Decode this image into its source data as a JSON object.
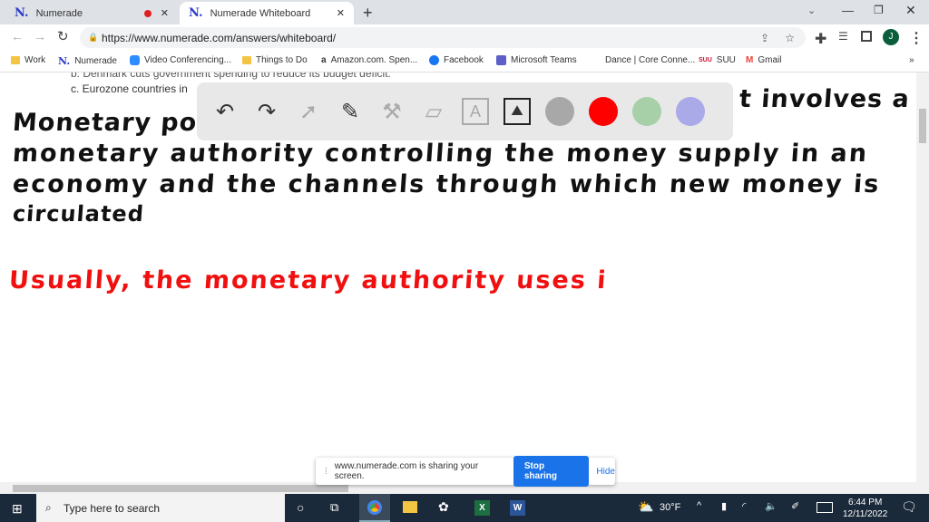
{
  "browser": {
    "tabs": [
      {
        "label": "Numerade",
        "recording": true
      },
      {
        "label": "Numerade Whiteboard",
        "active": true
      }
    ],
    "url": "https://www.numerade.com/answers/whiteboard/",
    "profile_initial": "J",
    "bookmarks": [
      "Work",
      "Numerade",
      "Video Conferencing...",
      "Things to Do",
      "Amazon.com. Spen...",
      "Facebook",
      "Microsoft Teams",
      "Dance | Core Conne...",
      "SUU",
      "Gmail"
    ]
  },
  "question": {
    "line_b": "b. Denmark cuts government spending to reduce its budget deficit.",
    "line_c": "c. Eurozone countries in"
  },
  "whiteboard": {
    "black_lines": [
      "Monetary pol",
      "t involves a",
      "monetary authority controlling the money supply in an",
      "economy and the channels through which new money is",
      "circulated"
    ],
    "red_line": "Usually, the monetary authority uses i",
    "colors": {
      "gray": "#a8a8a8",
      "red": "#ff0000",
      "green": "#a8d0a8",
      "purple": "#aaaae8"
    },
    "tools": [
      "undo-icon",
      "redo-icon",
      "pointer-icon",
      "pen-icon",
      "tools-icon",
      "eraser-icon",
      "text-icon",
      "image-icon"
    ]
  },
  "share_bar": {
    "message": "www.numerade.com is sharing your screen.",
    "stop": "Stop sharing",
    "hide": "Hide"
  },
  "taskbar": {
    "search_placeholder": "Type here to search",
    "weather": "30°F",
    "time": "6:44 PM",
    "date": "12/11/2022"
  }
}
